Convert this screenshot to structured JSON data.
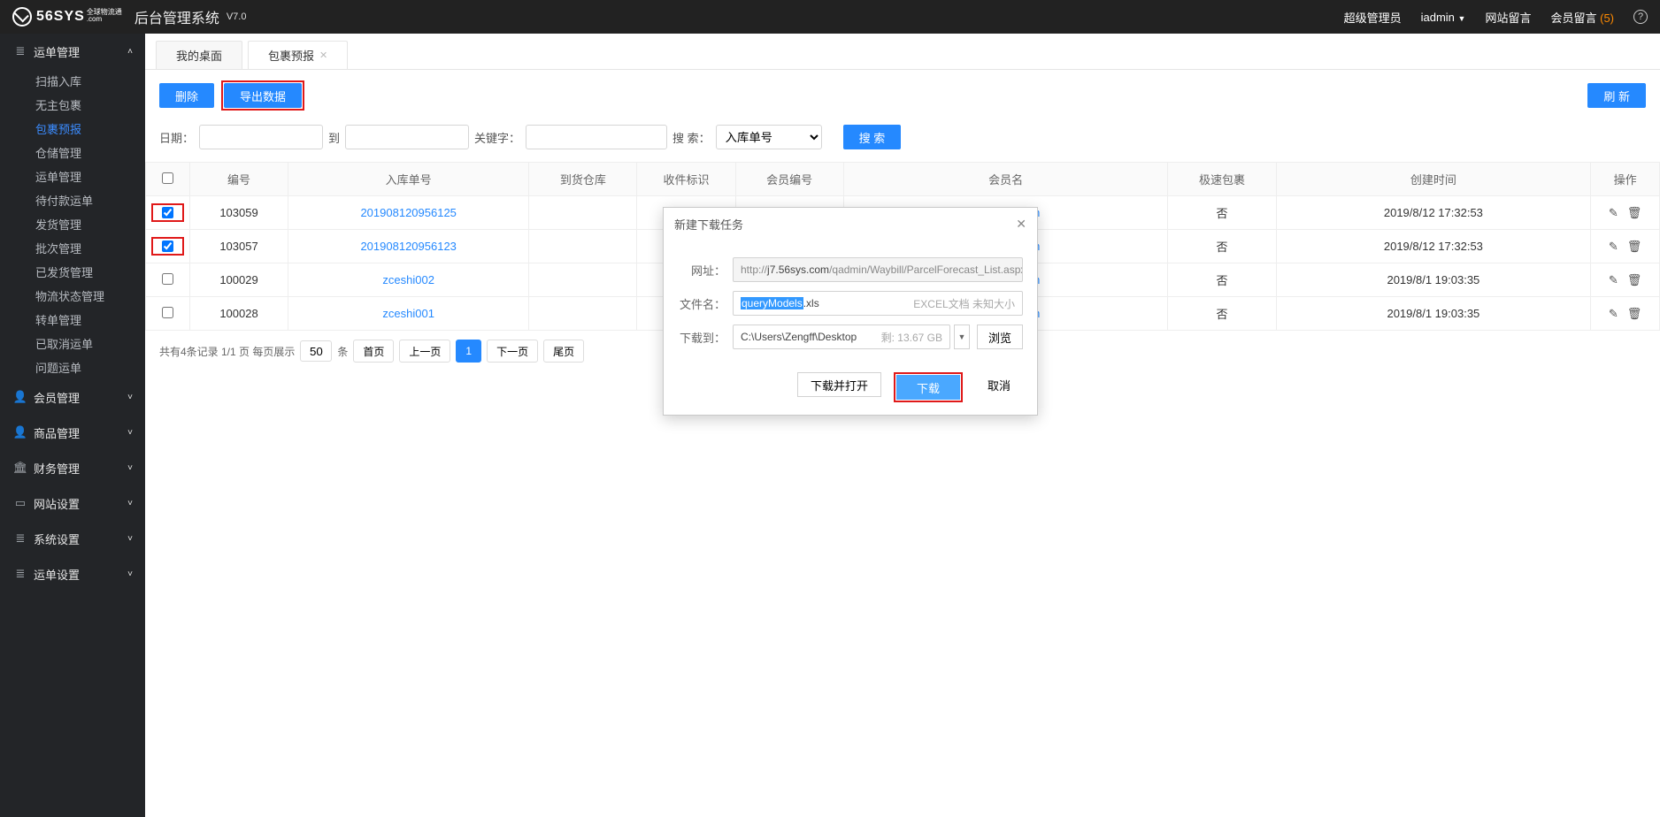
{
  "header": {
    "logo_text": "56SYS",
    "logo_sub_top": "全球物流通",
    "logo_sub_bottom": ".com",
    "system_title": "后台管理系统",
    "version": "V7.0",
    "role_label": "超级管理员",
    "user": "iadmin",
    "link_site_msg": "网站留言",
    "link_member_msg": "会员留言",
    "member_msg_count": "(5)",
    "help": "?"
  },
  "sidebar": {
    "groups": [
      {
        "icon": "≣",
        "label": "运单管理",
        "expanded": true,
        "children": [
          {
            "label": "扫描入库"
          },
          {
            "label": "无主包裹"
          },
          {
            "label": "包裹预报",
            "active": true
          },
          {
            "label": "仓储管理"
          },
          {
            "label": "运单管理"
          },
          {
            "label": "待付款运单"
          },
          {
            "label": "发货管理"
          },
          {
            "label": "批次管理"
          },
          {
            "label": "已发货管理"
          },
          {
            "label": "物流状态管理"
          },
          {
            "label": "转单管理"
          },
          {
            "label": "已取消运单"
          },
          {
            "label": "问题运单"
          }
        ]
      },
      {
        "icon": "👤",
        "label": "会员管理"
      },
      {
        "icon": "👤",
        "label": "商品管理"
      },
      {
        "icon": "🏛",
        "label": "财务管理"
      },
      {
        "icon": "▭",
        "label": "网站设置"
      },
      {
        "icon": "≣",
        "label": "系统设置"
      },
      {
        "icon": "≣",
        "label": "运单设置"
      }
    ]
  },
  "tabs": [
    {
      "label": "我的桌面",
      "closable": false
    },
    {
      "label": "包裹预报",
      "closable": true
    }
  ],
  "toolbar": {
    "delete": "删除",
    "export": "导出数据",
    "refresh": "刷 新"
  },
  "filters": {
    "date_label": "日期：",
    "to_label": "到",
    "keyword_label": "关键字：",
    "search_label": "搜 索：",
    "search_option": "入库单号",
    "search_btn": "搜 索"
  },
  "table": {
    "headers": {
      "id": "编号",
      "order": "入库单号",
      "warehouse": "到货仓库",
      "mark": "收件标识",
      "member_id": "会员编号",
      "member_name": "会员名",
      "fast": "极速包裹",
      "created": "创建时间",
      "op": "操作"
    },
    "rows": [
      {
        "checked": true,
        "hl": true,
        "id": "103059",
        "order": "201908120956125",
        "member_name": "195@qq.com",
        "fast": "否",
        "created": "2019/8/12 17:32:53"
      },
      {
        "checked": true,
        "hl": true,
        "id": "103057",
        "order": "201908120956123",
        "member_name": "195@qq.com",
        "fast": "否",
        "created": "2019/8/12 17:32:53"
      },
      {
        "checked": false,
        "hl": false,
        "id": "100029",
        "order": "zceshi002",
        "member_name": "502@qq.com",
        "fast": "否",
        "created": "2019/8/1 19:03:35"
      },
      {
        "checked": false,
        "hl": false,
        "id": "100028",
        "order": "zceshi001",
        "member_name": "502@qq.com",
        "fast": "否",
        "created": "2019/8/1 19:03:35"
      }
    ]
  },
  "pager": {
    "summary": "共有4条记录  1/1 页  每页展示",
    "per_page": "50",
    "per_page_suffix": "条",
    "first": "首页",
    "prev": "上一页",
    "page": "1",
    "next": "下一页",
    "last": "尾页"
  },
  "dialog": {
    "title": "新建下载任务",
    "url_label": "网址：",
    "url_prefix": "http://",
    "url_host": "j7.56sys.com",
    "url_path": "/qadmin/Waybill/ParcelForecast_List.aspx",
    "file_label": "文件名：",
    "file_sel": "queryModels",
    "file_ext": ".xls",
    "file_type_hint": "EXCEL文档",
    "file_size_hint": "未知大小",
    "path_label": "下载到：",
    "path_value": "C:\\Users\\Zengff\\Desktop",
    "disk_free": "剩: 13.67 GB",
    "browse": "浏览",
    "open_btn": "下载并打开",
    "download_btn": "下载",
    "cancel_btn": "取消"
  }
}
